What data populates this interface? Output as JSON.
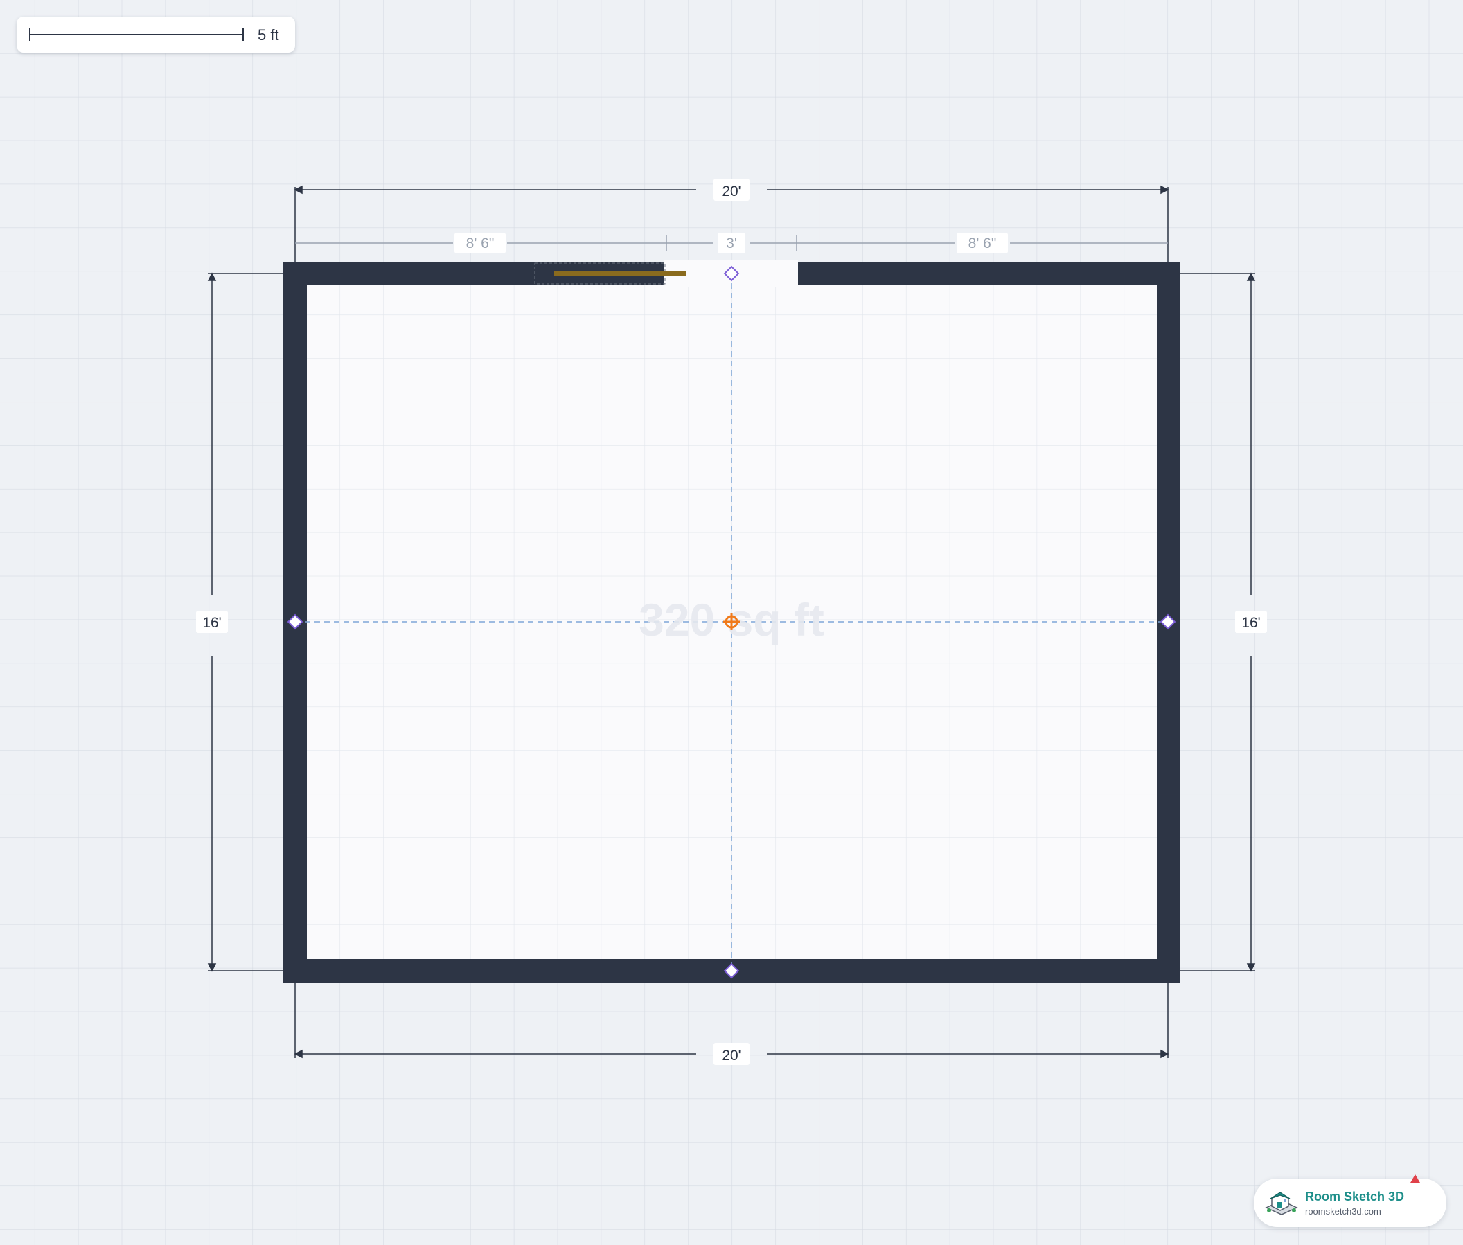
{
  "scale_bar": {
    "label": "5 ft"
  },
  "room": {
    "area_label": "320 sq ft",
    "dimensions": {
      "top_overall": "20'",
      "bottom_overall": "20'",
      "left_height": "16'",
      "right_height": "16'",
      "top_left_segment": "8' 6\"",
      "door_width": "3'",
      "top_right_segment": "8' 6\""
    }
  },
  "brand": {
    "name": "Room Sketch 3D",
    "url": "roomsketch3d.com"
  },
  "colors": {
    "background": "#eef1f5",
    "grid": "#d6dbe3",
    "wall": "#2d3545",
    "floor": "#fafafc",
    "door": "#8a6b1e",
    "guide": "#7ea6d8",
    "handle": "#7b5cd6",
    "center_handle": "#f07a1a",
    "brand_accent": "#1e8f8a"
  }
}
